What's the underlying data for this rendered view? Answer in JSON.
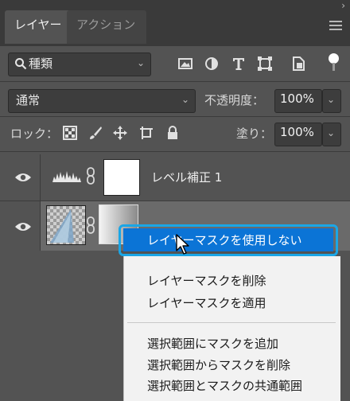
{
  "tabs": [
    {
      "label": "レイヤー",
      "active": true
    },
    {
      "label": "アクション",
      "active": false
    }
  ],
  "filter": {
    "label": "種類"
  },
  "blend": {
    "mode": "通常"
  },
  "opacity": {
    "label": "不透明度：",
    "value": "100%"
  },
  "lock": {
    "label": "ロック："
  },
  "fill": {
    "label": "塗り：",
    "value": "100%"
  },
  "layers": [
    {
      "name": "レベル補正 1",
      "visible": true
    },
    {
      "name": "",
      "visible": true
    }
  ],
  "context_menu": {
    "items": [
      {
        "label": "レイヤーマスクを使用しない",
        "selected": true
      },
      {
        "label": "レイヤーマスクを削除"
      },
      {
        "label": "レイヤーマスクを適用"
      },
      {
        "label": "選択範囲にマスクを追加"
      },
      {
        "label": "選択範囲からマスクを削除"
      },
      {
        "label": "選択範囲とマスクの共通範囲"
      }
    ]
  },
  "colors": {
    "panel_bg": "#535353",
    "selected_layer_bg": "#6a6a6a",
    "menu_highlight": "#0b74d6",
    "callout_border": "#1aa6e6"
  }
}
